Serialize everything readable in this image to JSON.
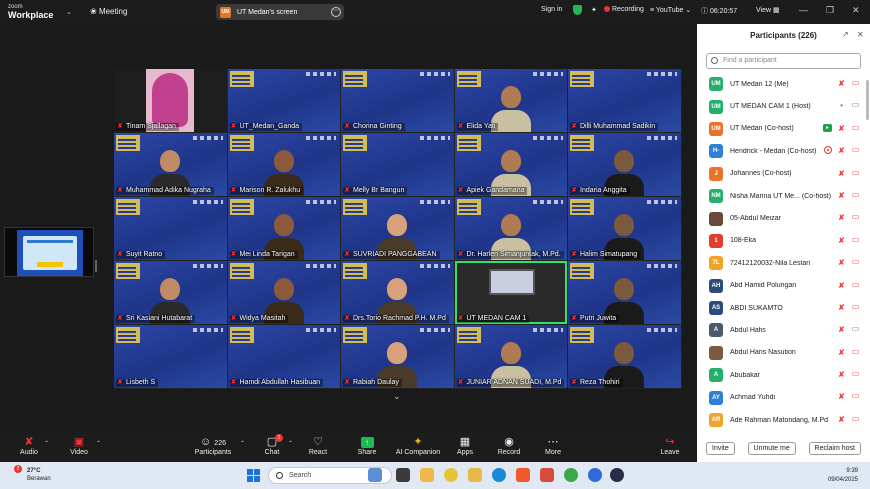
{
  "topbar": {
    "brand_small": "zoom",
    "brand_big": "Workplace",
    "meeting_label": "Meeting",
    "screen_avatar": "UM",
    "screen_label": "UT Medan's screen",
    "sign_in": "Sign in",
    "recording": "Recording",
    "youtube": "YouTube",
    "timer": "06:20:57",
    "view": "View"
  },
  "tiles": [
    {
      "name": "Tinam Sjallagan"
    },
    {
      "name": "UT_Medan_Ganda"
    },
    {
      "name": "Chorina Ginting"
    },
    {
      "name": "Elida Yati"
    },
    {
      "name": "Dilli Muhammad Sadikin"
    },
    {
      "name": "Muhammad Adika Nugraha"
    },
    {
      "name": "Marison R. Zalukhu"
    },
    {
      "name": "Melly Br Bangun"
    },
    {
      "name": "Apiek Gandamana"
    },
    {
      "name": "Indaria Anggita"
    },
    {
      "name": "Suyit Ratno"
    },
    {
      "name": "Mei Linda Tarigan"
    },
    {
      "name": "SUVRIADI PANGGABEAN"
    },
    {
      "name": "Dr. Harlen Simanjuntak, M.Pd."
    },
    {
      "name": "Halim Simatupang"
    },
    {
      "name": "Sri Kasiani Hutabarat"
    },
    {
      "name": "Widya Masitah"
    },
    {
      "name": "Drs.Torio Rachmad P.H. M.Pd"
    },
    {
      "name": "UT MEDAN CAM 1"
    },
    {
      "name": "Putri Juwita"
    },
    {
      "name": "Lisbeth S"
    },
    {
      "name": "Hamdi Abdullah Hasibuan"
    },
    {
      "name": "Rabiah Daulay"
    },
    {
      "name": "JUNIAR ADNAN SUADI, M.Pd"
    },
    {
      "name": "Reza Thohiri"
    }
  ],
  "panel": {
    "title": "Participants (226)",
    "search_placeholder": "Find a participant",
    "buttons": {
      "invite": "Invite",
      "unmute": "Unmute me",
      "reclaim": "Reclaim host"
    },
    "participants": [
      {
        "initials": "UM",
        "color": "#24b06a",
        "name": "UT Medan 12 (Me)",
        "mic": "off",
        "cam": "off"
      },
      {
        "initials": "UM",
        "color": "#24b06a",
        "name": "UT MEDAN CAM 1 (Host)",
        "mic": "on",
        "cam": "on"
      },
      {
        "initials": "UM",
        "color": "#e8742a",
        "name": "UT Medan (Co-host)",
        "mic": "off",
        "cam": "off",
        "share": true
      },
      {
        "initials": "H-",
        "color": "#2f7ed8",
        "name": "Hendrick - Medan (Co-host)",
        "mic": "off",
        "cam": "off",
        "rec": true
      },
      {
        "initials": "J",
        "color": "#e8742a",
        "name": "Johannes (Co-host)",
        "mic": "off",
        "cam": "off"
      },
      {
        "initials": "NM",
        "color": "#24b06a",
        "name": "Nisha Marina UT Me... (Co-host)",
        "mic": "off",
        "cam": "off"
      },
      {
        "initials": "",
        "color": "#6b4a3a",
        "name": "05-Abdul Meizar",
        "mic": "off",
        "cam": "off"
      },
      {
        "initials": "1",
        "color": "#e33b2e",
        "name": "108-Eka",
        "mic": "off",
        "cam": "off"
      },
      {
        "initials": "7L",
        "color": "#f0a52a",
        "name": "72412120032-Nila Lestari",
        "mic": "off",
        "cam": "off"
      },
      {
        "initials": "AH",
        "color": "#2c4d7a",
        "name": "Abd Hamid Polungan",
        "mic": "off",
        "cam": "off"
      },
      {
        "initials": "AS",
        "color": "#2c4d7a",
        "name": "ABDI SUKAMTO",
        "mic": "off",
        "cam": "off"
      },
      {
        "initials": "A",
        "color": "#4a5a6a",
        "name": "Abdul Hafis",
        "mic": "off",
        "cam": "on"
      },
      {
        "initials": "",
        "color": "#7a5a40",
        "name": "Abdul Haris Nasution",
        "mic": "off",
        "cam": "off"
      },
      {
        "initials": "A",
        "color": "#24b06a",
        "name": "Abubakar",
        "mic": "off",
        "cam": "off"
      },
      {
        "initials": "AY",
        "color": "#2f7ed8",
        "name": "Achmad Yuhdi",
        "mic": "off",
        "cam": "off"
      },
      {
        "initials": "AR",
        "color": "#f0a52a",
        "name": "Ade Rahman Matondang, M.Pd",
        "mic": "off",
        "cam": "off"
      }
    ]
  },
  "toolbar": {
    "audio": "Audio",
    "video": "Video",
    "participants": "Participants",
    "participants_count": "226",
    "chat": "Chat",
    "chat_badge": "1",
    "react": "React",
    "share": "Share",
    "ai": "AI Companion",
    "apps": "Apps",
    "record": "Record",
    "more": "More",
    "leave": "Leave"
  },
  "taskbar": {
    "weather_badge": "2",
    "temp": "27°C",
    "condition": "Berawan",
    "search": "Search",
    "time": "9:39",
    "date": "09/04/2025"
  }
}
